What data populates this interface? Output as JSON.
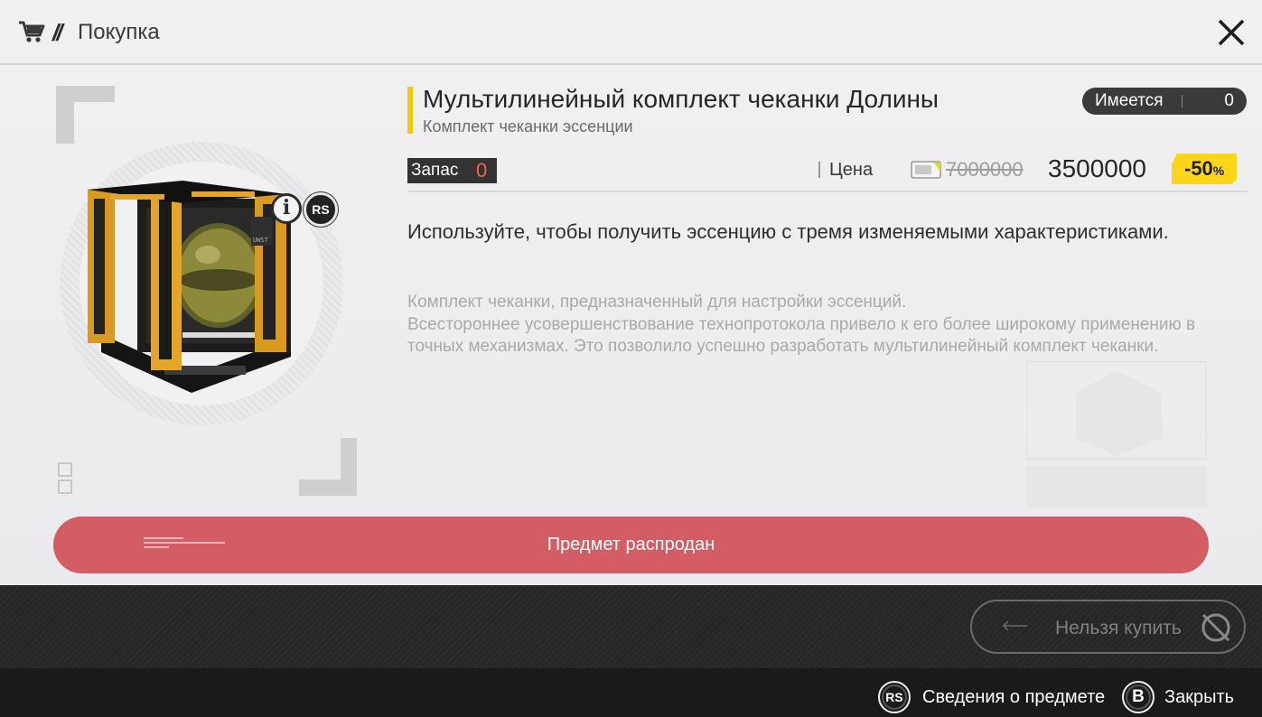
{
  "header": {
    "slash": "//",
    "title": "Покупка",
    "cart_icon": "cart-icon",
    "close_icon": "close-icon"
  },
  "item": {
    "name": "Мультилинейный комплект чеканки Долины",
    "category": "Комплект чеканки эссенции",
    "info_icon": "i",
    "rs_badge": "RS",
    "owned_label": "Имеется",
    "owned_value": "0",
    "stock_label": "Запас",
    "stock_value": "0",
    "price_label": "Цена",
    "price_old": "7000000",
    "price_new": "3500000",
    "discount": "-50",
    "discount_unit": "%",
    "description": "Используйте, чтобы получить эссенцию с тремя изменяемыми характеристиками.",
    "lore": "Комплект чеканки, предназначенный для настройки эссенций.\nВсестороннее усовершенствование технопротокола привело к его более широкому применению в точных механизмах. Это позволило успешно разработать мультилинейный комплект чеканки."
  },
  "actions": {
    "sold_out": "Предмет распродан",
    "cannot_buy": "Нельзя купить"
  },
  "footer": {
    "rs_key": "RS",
    "rs_label": "Сведения о предмете",
    "b_key": "B",
    "b_label": "Закрыть"
  },
  "colors": {
    "accent_yellow": "#f5c518",
    "discount_yellow": "#ffd51a",
    "sold_red": "#d35d65",
    "stock_red": "#ff5b5b"
  }
}
